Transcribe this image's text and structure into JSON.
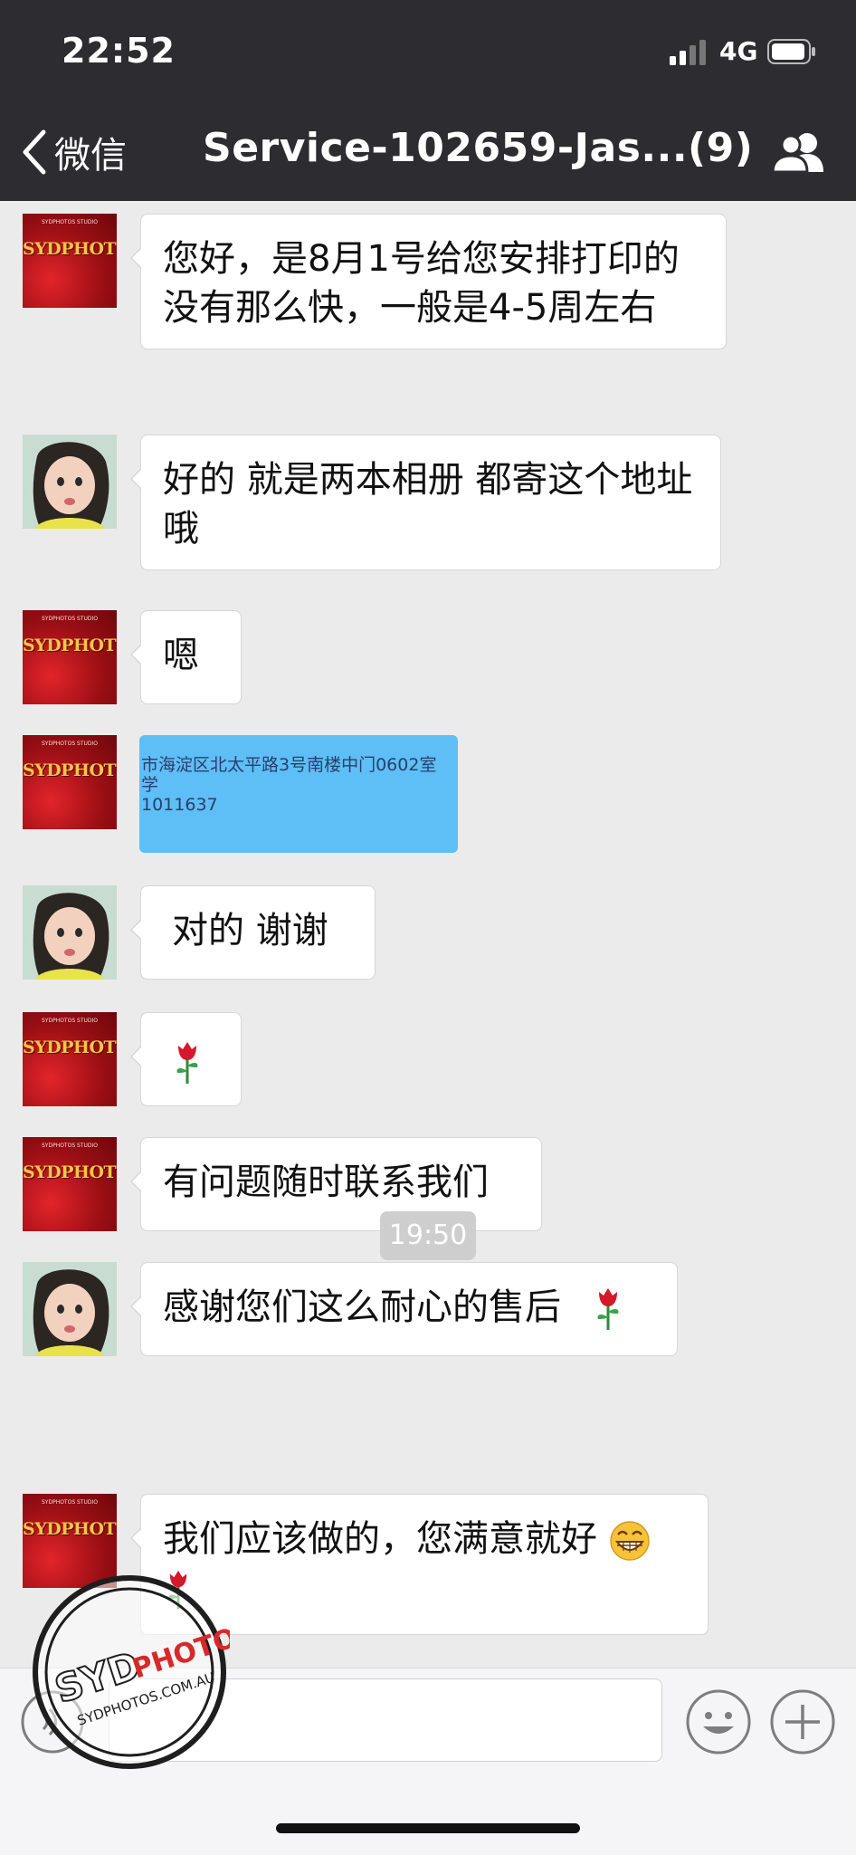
{
  "status_bar": {
    "time": "22:52",
    "network": "4G"
  },
  "nav": {
    "back_label": "微信",
    "title": "Service-102659-Jas...(9)"
  },
  "messages": [
    {
      "sender": "service",
      "text": "您好，是8月1号给您安排打印的没有那么快，一般是4-5周左右"
    },
    {
      "sender": "customer",
      "text": "好的 就是两本相册 都寄这个地址哦"
    },
    {
      "sender": "service",
      "text": "嗯"
    },
    {
      "sender": "service",
      "type": "image",
      "line1": "市海淀区北太平路3号南楼中门0602室",
      "line2": "学",
      "line3": "1011637"
    },
    {
      "sender": "customer",
      "text": "对的 谢谢"
    },
    {
      "sender": "service",
      "type": "rose"
    },
    {
      "sender": "service",
      "text": "有问题随时联系我们"
    },
    {
      "sender": "customer",
      "text": "感谢您们这么耐心的售后"
    },
    {
      "sender": "service",
      "text": "我们应该做的，您满意就好"
    }
  ],
  "timestamp": "19:50",
  "avatar_brand": {
    "text": "SYDPHOTOS",
    "caption": "SYDPHOTOS STUDIO"
  },
  "watermark": {
    "brand": "SYDPHOTOS",
    "url": "SYDPHOTOS.COM.AU"
  }
}
